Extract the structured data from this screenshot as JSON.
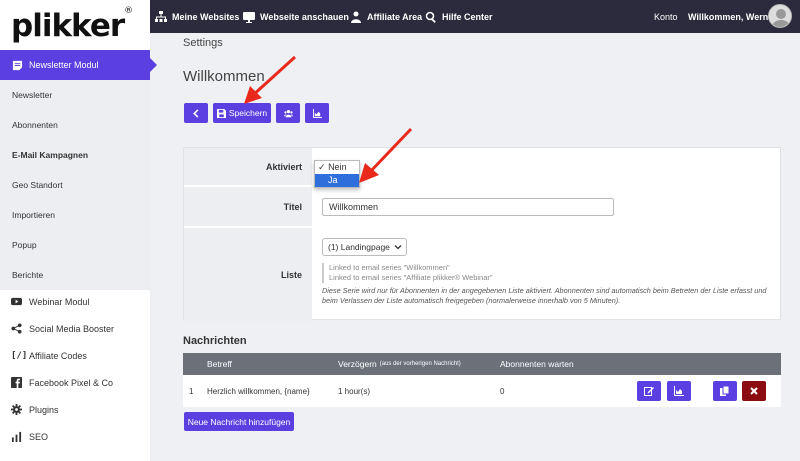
{
  "brand": {
    "logo": "plikker",
    "registered": "®"
  },
  "topnav": {
    "items": [
      "Meine Websites",
      "Webseite anschauen",
      "Affiliate Area",
      "Hilfe Center"
    ],
    "account": "Konto",
    "welcome": "Willkommen, Werner"
  },
  "sidebar": {
    "active": "Newsletter Modul",
    "sub_items": [
      "Newsletter",
      "Abonnenten",
      "E-Mail Kampagnen",
      "Geo Standort",
      "Importieren",
      "Popup",
      "Berichte"
    ],
    "main_items": [
      "Webinar Modul",
      "Social Media Booster",
      "Affiliate Codes",
      "Facebook Pixel & Co",
      "Plugins",
      "SEO"
    ],
    "affiliate_icon_text": "[/]"
  },
  "page": {
    "breadcrumb": "Settings",
    "title": "Willkommen",
    "save_label": "Speichern"
  },
  "form": {
    "activated_label": "Aktiviert",
    "activated_options": [
      "Nein",
      "Ja"
    ],
    "activated_checkmark": "✓",
    "title_label": "Titel",
    "title_value": "Willkommen",
    "list_label": "Liste",
    "list_value": "(1) Landingpage",
    "linked_series": [
      "Linked to email series \"Willkommen\"",
      "Linked to email series \"Affiliate plikker® Webinar\""
    ],
    "info_text": "Diese Serie wird nur für Abonnenten in der angegebenen Liste aktiviert. Abonnenten sind automatisch beim Betreten der Liste erfasst und beim Verlassen der Liste automatisch freigegeben (normalerweise innerhalb von 5 Minuten)."
  },
  "messages": {
    "title": "Nachrichten",
    "headers": {
      "subject": "Betreff",
      "delay": "Verzögern",
      "delay_note": "(aus der vorherigen Nachricht)",
      "waiting": "Abonnenten warten"
    },
    "rows": [
      {
        "num": "1",
        "subject": "Herzlich willkommen, {name}",
        "delay": "1 hour(s)",
        "waiting": "0"
      }
    ],
    "add_label": "Neue Nachricht hinzufügen"
  },
  "colors": {
    "accent": "#5b3fe0",
    "danger": "#8b0d12",
    "topbar": "#2b2b3d",
    "arrow": "#e8291c"
  }
}
